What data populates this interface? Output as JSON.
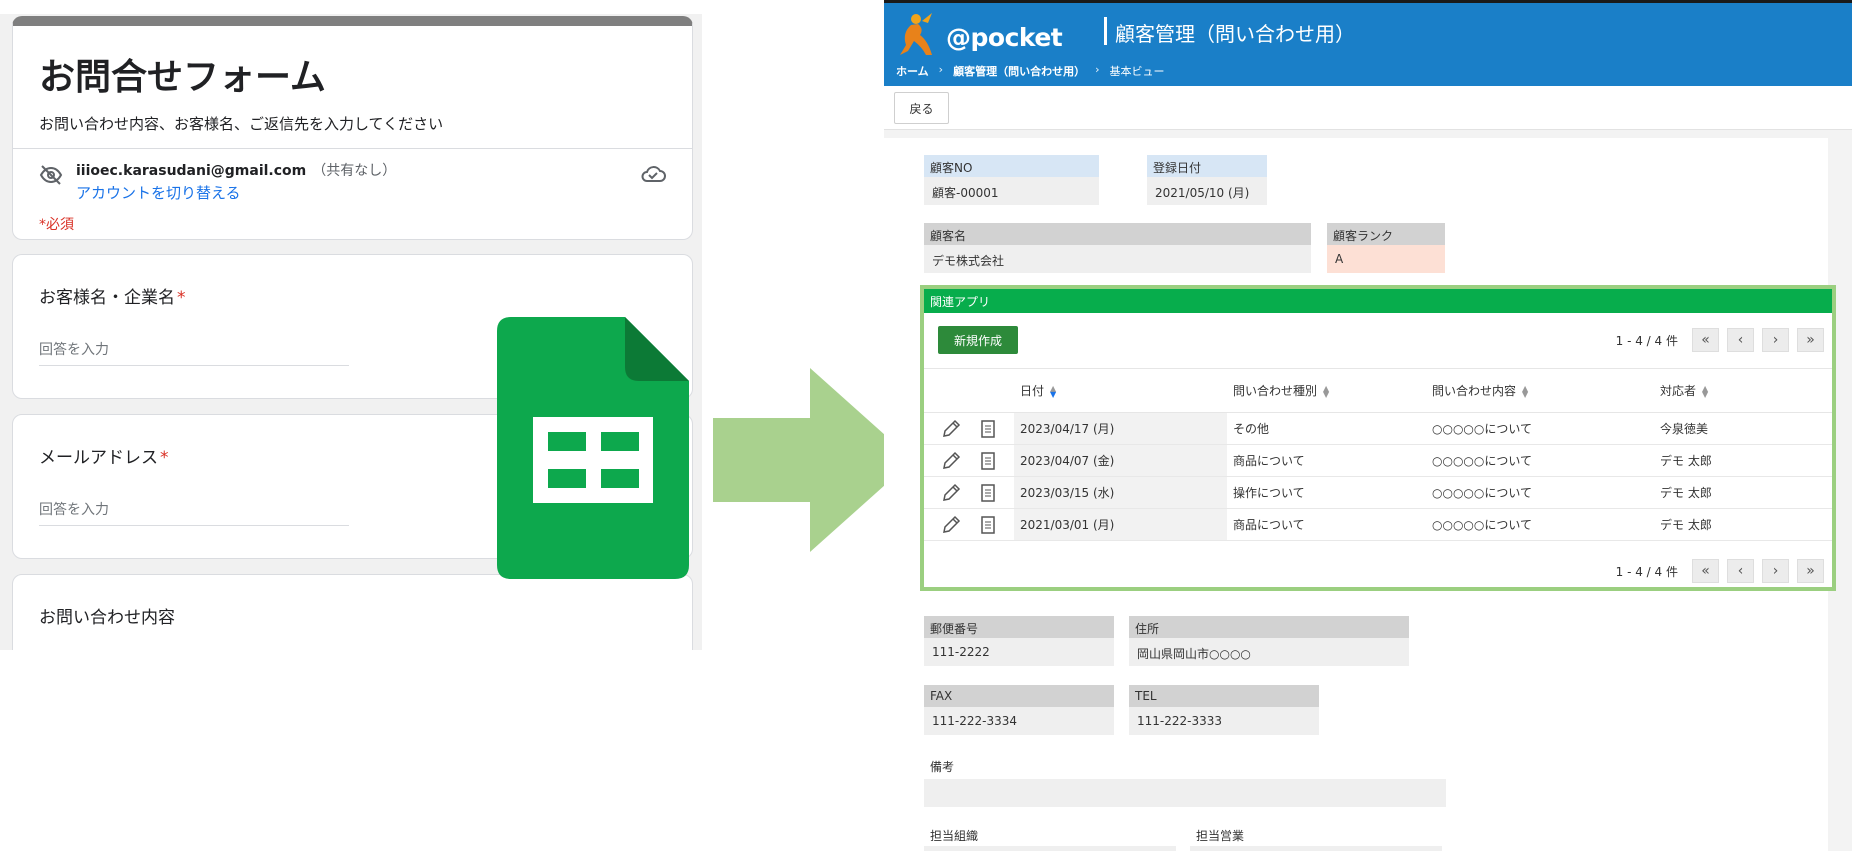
{
  "form": {
    "title": "お問合せフォーム",
    "description": "お問い合わせ内容、お客様名、ご返信先を入力してください",
    "account_email": "iiioec.karasudani@gmail.com",
    "account_share": "（共有なし）",
    "switch_account": "アカウントを切り替える",
    "required_note": "*必須",
    "questions": [
      {
        "label": "お客様名・企業名",
        "required": "*",
        "placeholder": "回答を入力"
      },
      {
        "label": "メールアドレス",
        "required": "*",
        "placeholder": "回答を入力"
      },
      {
        "label": "お問い合わせ内容"
      }
    ]
  },
  "app": {
    "logo": "@pocket",
    "title": "顧客管理（問い合わせ用）",
    "breadcrumb": {
      "home": "ホーム",
      "app": "顧客管理（問い合わせ用）",
      "view": "基本ビュー",
      "sep": "›"
    },
    "back_button": "戻る",
    "fields": {
      "customer_no": {
        "label": "顧客NO",
        "value": "顧客-00001"
      },
      "registered": {
        "label": "登録日付",
        "value": "2021/05/10 (月)"
      },
      "customer_name": {
        "label": "顧客名",
        "value": "デモ株式会社"
      },
      "rank": {
        "label": "顧客ランク",
        "value": "A"
      },
      "postal": {
        "label": "郵便番号",
        "value": "111-2222"
      },
      "address": {
        "label": "住所",
        "value": "岡山県岡山市○○○○"
      },
      "fax": {
        "label": "FAX",
        "value": "111-222-3334"
      },
      "tel": {
        "label": "TEL",
        "value": "111-222-3333"
      },
      "notes": {
        "label": "備考",
        "value": ""
      },
      "org": {
        "label": "担当組織"
      },
      "sales": {
        "label": "担当営業"
      }
    },
    "related": {
      "header": "関連アプリ",
      "new_button": "新規作成",
      "pager_text": "1 - 4 / 4 件",
      "pager_first": "«",
      "pager_prev": "‹",
      "pager_next": "›",
      "pager_last": "»",
      "columns": [
        "日付",
        "問い合わせ種別",
        "問い合わせ内容",
        "対応者"
      ],
      "rows": [
        {
          "date": "2023/04/17 (月)",
          "type": "その他",
          "content": "○○○○○について",
          "person": "今泉徳美"
        },
        {
          "date": "2023/04/07 (金)",
          "type": "商品について",
          "content": "○○○○○について",
          "person": "デモ 太郎"
        },
        {
          "date": "2023/03/15 (水)",
          "type": "操作について",
          "content": "○○○○○について",
          "person": "デモ 太郎"
        },
        {
          "date": "2021/03/01 (月)",
          "type": "商品について",
          "content": "○○○○○について",
          "person": "デモ 太郎"
        }
      ]
    }
  },
  "colors": {
    "header_blue": "#1a7fc8",
    "related_green": "#07ad4c",
    "sheets_green": "#0da84d",
    "arrow_green": "#a9d18e",
    "required_red": "#d93025",
    "link_blue": "#1a73e8"
  },
  "icons": [
    "eye-off-icon",
    "cloud-check-icon",
    "google-sheets-icon",
    "right-arrow-icon",
    "pencil-icon",
    "document-icon",
    "kangaroo-logo-icon",
    "sort-icon"
  ]
}
